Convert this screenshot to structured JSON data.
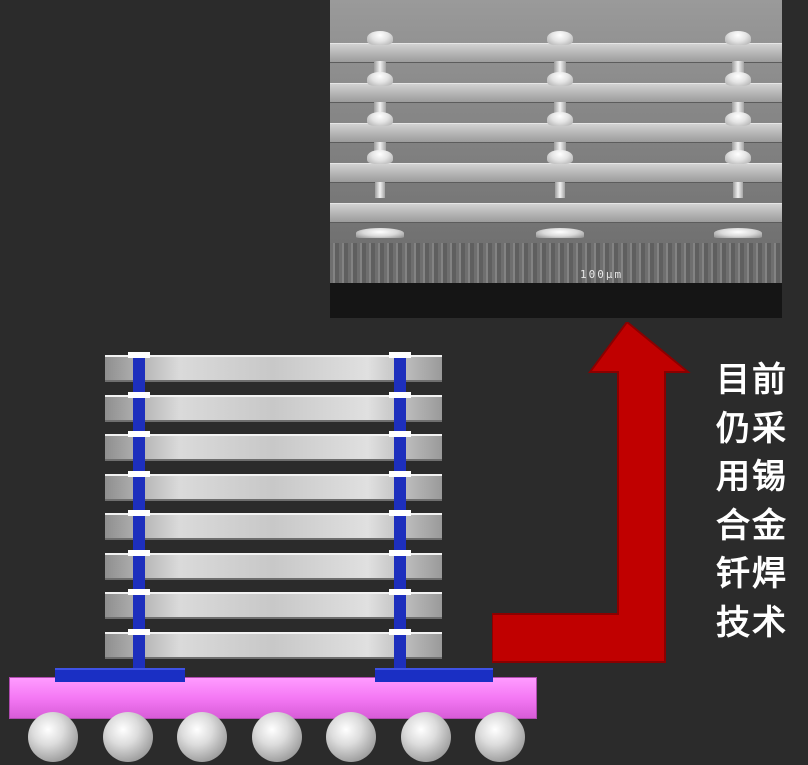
{
  "figure": {
    "sem_scale_label": "100μm",
    "caption_lines": [
      "目前",
      "仍采",
      "用锡",
      "合金",
      "钎焊",
      "技术"
    ]
  },
  "colors": {
    "background": "#2b2b2b",
    "arrow": "#c00000",
    "substrate": "#f07af0",
    "via": "#1d2fbd",
    "caption_text": "#ffffff"
  },
  "stack": {
    "die_count": 8,
    "via_columns": 2,
    "solder_ball_count": 7
  },
  "sem": {
    "layer_count": 6,
    "bump_columns": 3
  }
}
